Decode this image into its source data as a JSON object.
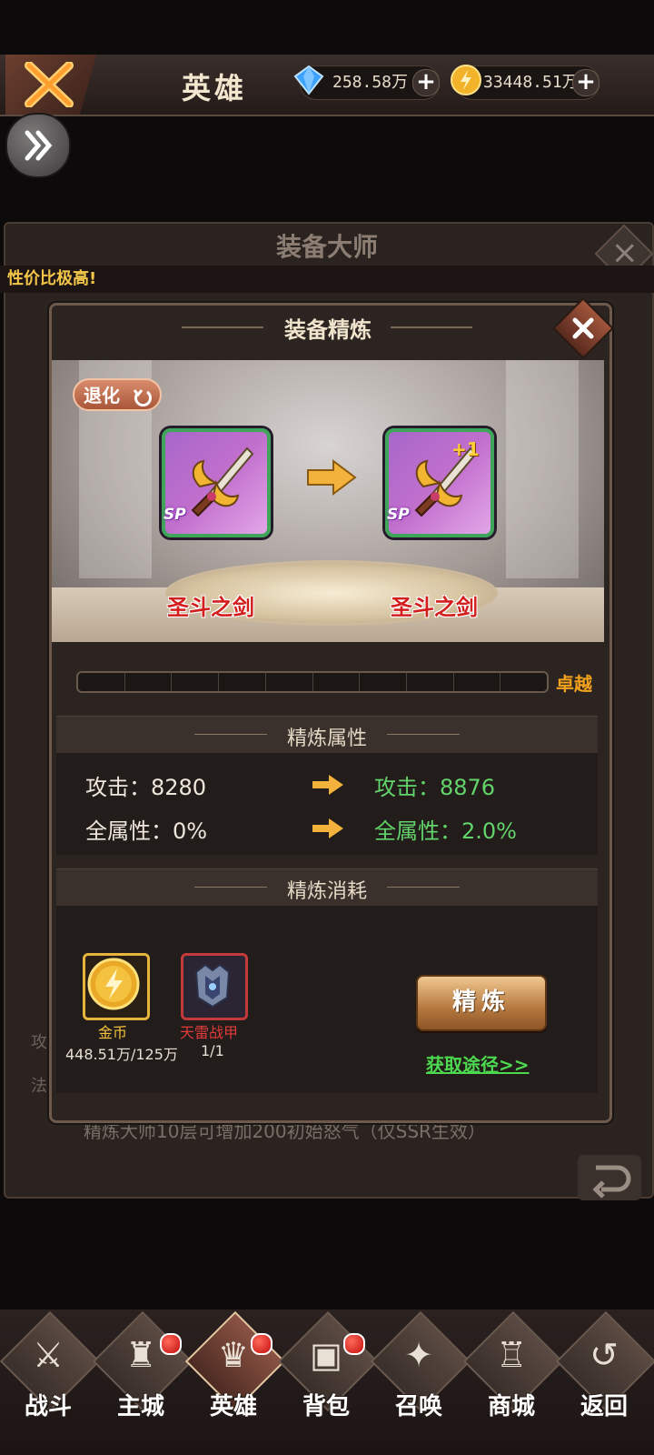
{
  "header": {
    "title": "英雄",
    "diamond_amount": "258.58万",
    "gold_amount": "33448.51万"
  },
  "background_panel": {
    "title": "装备大师",
    "promo": "性价比极高!",
    "row_a": "攻",
    "row_b": "法",
    "footnote": "精炼大师10层可增加200初始怒气（仅SSR生效）"
  },
  "modal": {
    "title": "装备精炼",
    "degrade_label": "退化",
    "current_item": {
      "name": "圣斗之剑",
      "tag": "SP"
    },
    "next_item": {
      "name": "圣斗之剑",
      "tag": "SP",
      "plus": "+1"
    },
    "grade_label": "卓越",
    "progress_fraction": 0,
    "attributes_title": "精炼属性",
    "attributes": [
      {
        "before": "攻击：8280",
        "after": "攻击：8876"
      },
      {
        "before": "全属性：0%",
        "after": "全属性：2.0%"
      }
    ],
    "cost_title": "精炼消耗",
    "costs": [
      {
        "name": "金币",
        "amount": "448.51万/125万",
        "name_color": "#f3c23c"
      },
      {
        "name": "天雷战甲",
        "amount": "1/1",
        "name_color": "#e23b3b"
      }
    ],
    "refine_button": "精炼",
    "source_link": "获取途径>>"
  },
  "nav": {
    "items": [
      {
        "label": "战斗",
        "icon": "swords-icon",
        "badge": false
      },
      {
        "label": "主城",
        "icon": "castle-icon",
        "badge": true
      },
      {
        "label": "英雄",
        "icon": "hero-icon",
        "badge": true,
        "active": true
      },
      {
        "label": "背包",
        "icon": "backpack-icon",
        "badge": true
      },
      {
        "label": "召唤",
        "icon": "summon-icon",
        "badge": false
      },
      {
        "label": "商城",
        "icon": "shop-icon",
        "badge": false
      },
      {
        "label": "返回",
        "icon": "return-icon",
        "badge": false
      }
    ]
  }
}
